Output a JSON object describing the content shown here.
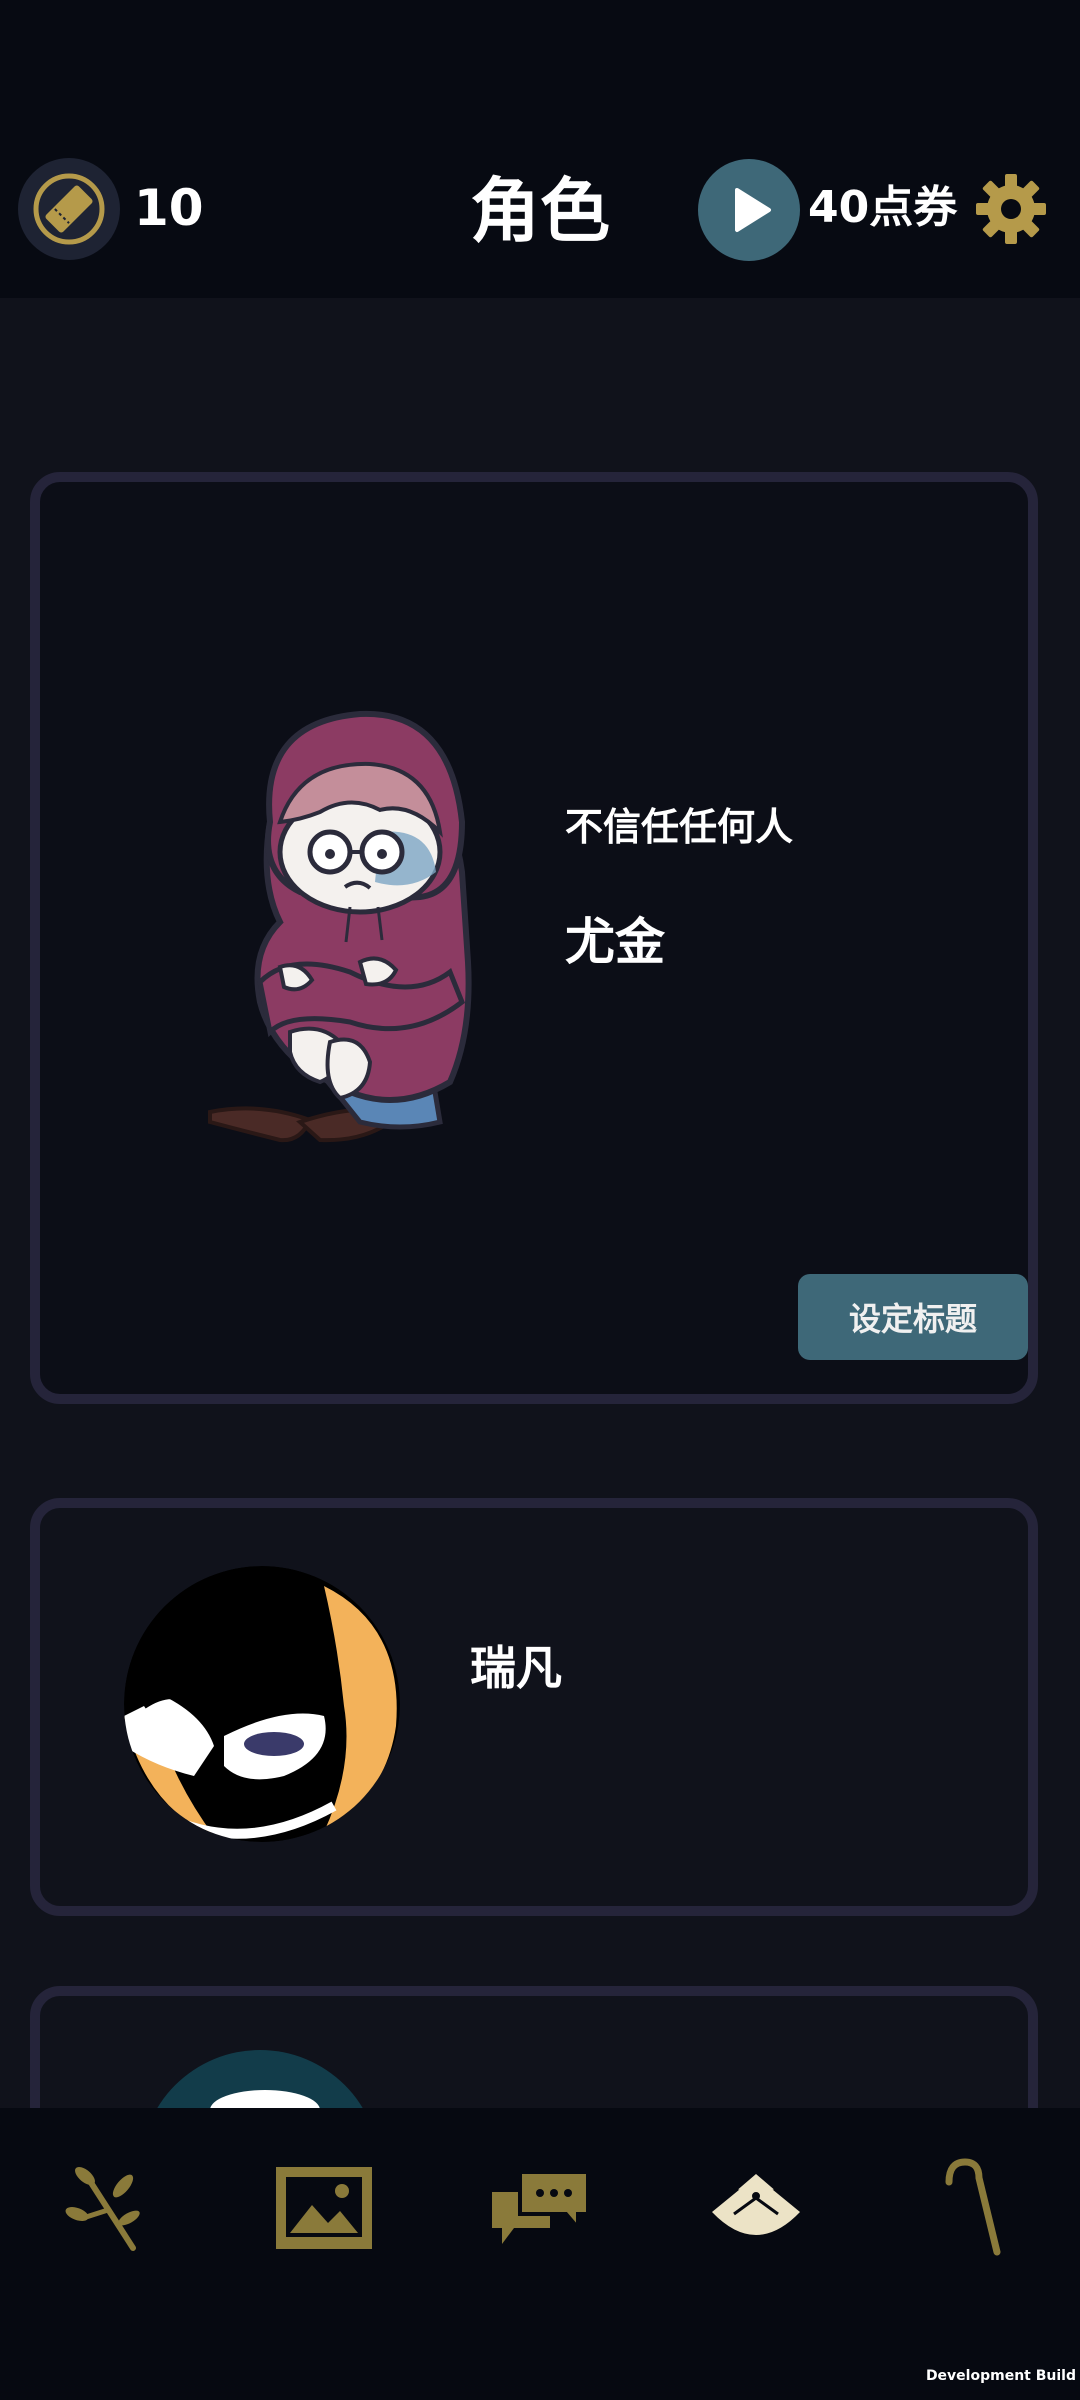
{
  "header": {
    "ticket_count": "10",
    "title": "角色",
    "voucher_label": "40点券"
  },
  "characters": [
    {
      "motto": "不信任任何人",
      "name": "尤金",
      "set_title_label": "设定标题"
    },
    {
      "name": "瑞凡"
    }
  ],
  "bottom_nav": {
    "items": [
      {
        "icon": "branch-icon"
      },
      {
        "icon": "gallery-icon"
      },
      {
        "icon": "chat-icon"
      },
      {
        "icon": "fan-icon"
      },
      {
        "icon": "cane-icon"
      }
    ]
  },
  "footer": {
    "dev_build": "Development Build"
  },
  "colors": {
    "accent_gold": "#b59a4a",
    "accent_teal": "#3e6878",
    "card_border": "#25243a",
    "background": "#10121b"
  }
}
